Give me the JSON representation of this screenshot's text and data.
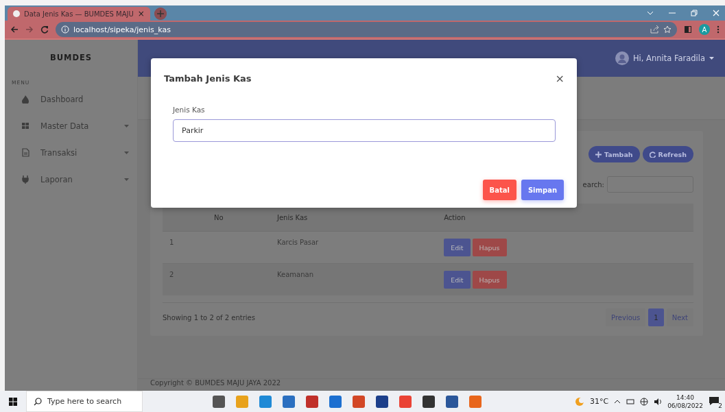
{
  "browser": {
    "tab_title": "Data Jenis Kas — BUMDES MAJU",
    "tab_close": "×",
    "url": "localhost/sipeka/jenis_kas",
    "profile_initial": "A"
  },
  "sidebar": {
    "brand": "BUMDES",
    "section": "MENU",
    "items": [
      {
        "label": "Dashboard",
        "expandable": false
      },
      {
        "label": "Master Data",
        "expandable": true
      },
      {
        "label": "Transaksi",
        "expandable": true
      },
      {
        "label": "Laporan",
        "expandable": true
      }
    ]
  },
  "topbar": {
    "user": "Hi, Annita Faradila"
  },
  "card": {
    "buttons": [
      {
        "label": "Tambah",
        "kind": "add"
      },
      {
        "label": "Refresh",
        "kind": "refresh"
      }
    ],
    "search_label": "earch:",
    "table": {
      "columns": [
        "No",
        "Jenis Kas",
        "Action"
      ],
      "rows": [
        {
          "no": "1",
          "jenis_kas": "Karcis Pasar",
          "actions": [
            "Edit",
            "Hapus"
          ]
        },
        {
          "no": "2",
          "jenis_kas": "Keamanan",
          "actions": [
            "Edit",
            "Hapus"
          ]
        }
      ]
    },
    "info": "Showing 1 to 2 of 2 entries",
    "pagination": [
      {
        "label": "Previous",
        "selected": false,
        "disabled": true
      },
      {
        "label": "1",
        "selected": true,
        "disabled": false
      },
      {
        "label": "Next",
        "selected": false,
        "disabled": true
      }
    ]
  },
  "footer": "Copyright © BUMDES MAJU JAYA 2022",
  "modal": {
    "title": "Tambah Jenis Kas",
    "close": "×",
    "field_label": "Jenis Kas",
    "field_value": "Parkir",
    "buttons": [
      {
        "label": "Batal",
        "kind": "cancel"
      },
      {
        "label": "Simpan",
        "kind": "save"
      }
    ]
  },
  "taskbar": {
    "search_placeholder": "Type here to search",
    "weather": "31°C",
    "time": "14:40",
    "date": "06/08/2022",
    "notifications": "2"
  }
}
